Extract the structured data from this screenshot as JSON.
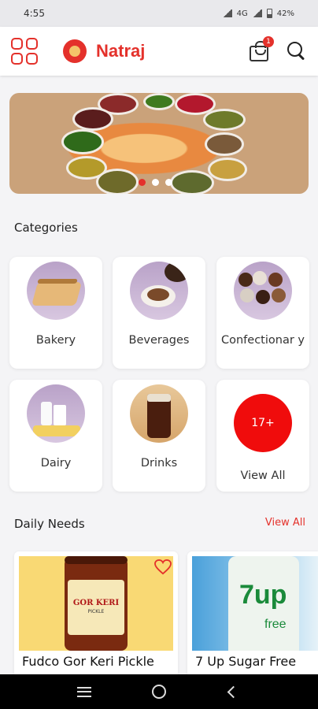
{
  "status_bar": {
    "time": "4:55",
    "network": "4G",
    "battery": "42%"
  },
  "app_bar": {
    "brand": "Natraj",
    "cart_count": "1",
    "brand_color": "#e4312b"
  },
  "banner": {
    "slides": 3,
    "active_slide": 1
  },
  "categories": {
    "title": "Categories",
    "items": [
      {
        "label": "Bakery",
        "icon": "bread-image"
      },
      {
        "label": "Beverages",
        "icon": "coffee-image"
      },
      {
        "label": "Confectionar y",
        "icon": "chocolates-image"
      },
      {
        "label": "Dairy",
        "icon": "milk-image"
      },
      {
        "label": "Drinks",
        "icon": "cola-image"
      }
    ],
    "view_all": {
      "badge": "17+",
      "label": "View All"
    }
  },
  "daily_needs": {
    "title": "Daily Needs",
    "view_all": "View All",
    "products": [
      {
        "name": "Fudco Gor Keri Pickle",
        "jar_label": "GOR KERI",
        "jar_sub": "PICKLE"
      },
      {
        "name": "7 Up Sugar Free",
        "brand_text": "7up",
        "sub_text": "free"
      }
    ]
  },
  "nav": {
    "buttons": [
      "recent-apps",
      "home",
      "back"
    ]
  }
}
